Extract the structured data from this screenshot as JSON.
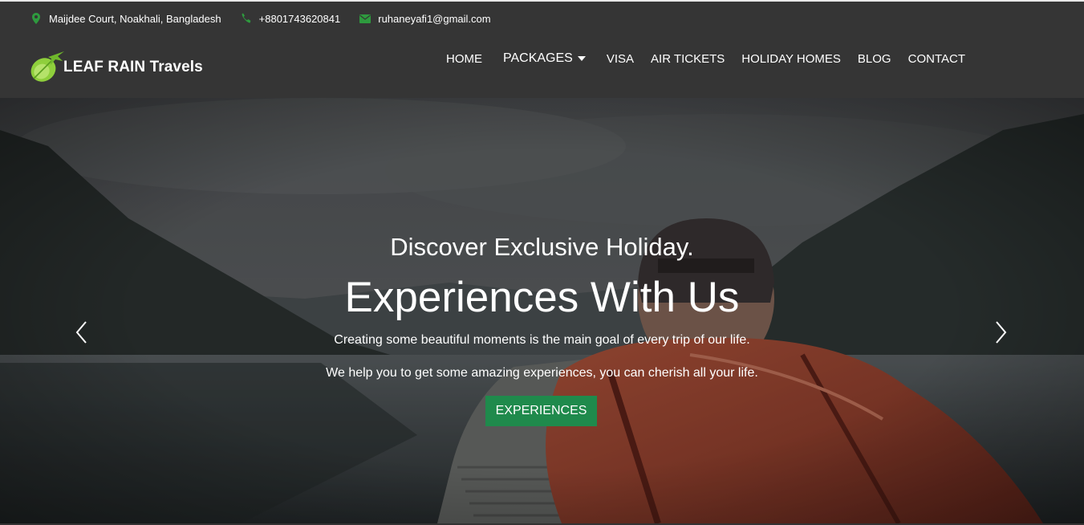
{
  "contact": {
    "address": "Maijdee Court, Noakhali, Bangladesh",
    "phone": "+8801743620841",
    "email": "ruhaneyafi1@gmail.com",
    "address_icon": "map-marker-icon",
    "phone_icon": "phone-icon",
    "email_icon": "envelope-icon"
  },
  "brand": {
    "name": "LEAF RAIN Travels",
    "logo_icon": "leaf-plane-icon"
  },
  "nav": {
    "home": "HOME",
    "packages": "PACKAGES",
    "visa": "VISA",
    "air_tickets": "AIR TICKETS",
    "holiday_homes": "HOLIDAY HOMES",
    "blog": "BLOG",
    "contact": "CONTACT"
  },
  "hero": {
    "subtitle": "Discover Exclusive Holiday.",
    "title": "Experiences With Us",
    "line1": "Creating some beautiful moments is the main goal of every trip of our life.",
    "line2": "We help you to get some amazing experiences, you can cherish all your life.",
    "button": "EXPERIENCES"
  },
  "colors": {
    "header_bg": "#353535",
    "accent_green": "#1f8a4c",
    "icon_green": "#2e9a3e"
  }
}
